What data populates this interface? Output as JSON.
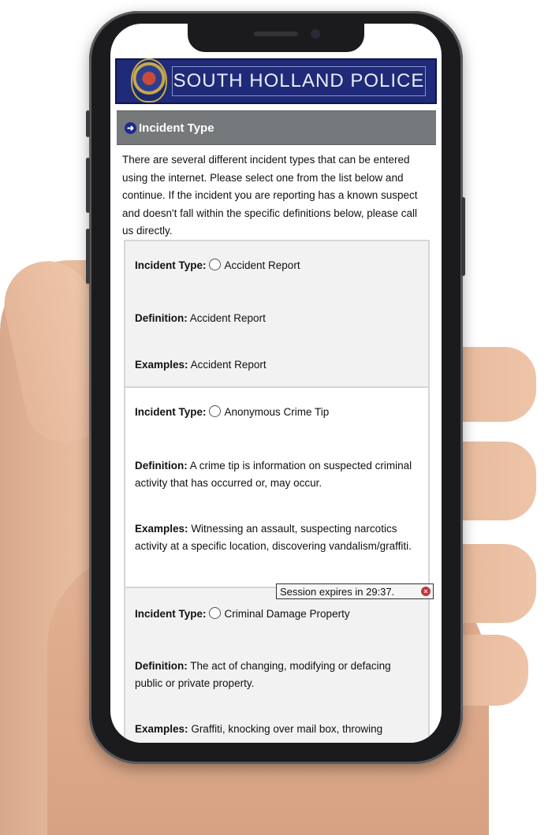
{
  "header": {
    "agency_name": "SOUTH HOLLAND POLICE",
    "badge_icon": "police-badge-icon"
  },
  "section": {
    "title": "Incident Type",
    "icon": "arrow-circle-icon"
  },
  "intro_text": "There are several different incident types that can be entered using the internet. Please select one from the list below and continue. If the incident you are reporting has a known suspect and doesn't fall within the specific definitions below, please call us directly.",
  "labels": {
    "incident_type": "Incident Type:",
    "definition": "Definition:",
    "examples": "Examples:"
  },
  "incident_types": [
    {
      "name": "Accident Report",
      "definition": "Accident Report",
      "examples": "Accident Report"
    },
    {
      "name": "Anonymous Crime Tip",
      "definition": "A crime tip is information on suspected criminal activity that has occurred or, may occur.",
      "examples": "Witnessing an assault, suspecting narcotics activity at a specific location, discovering vandalism/graffiti."
    },
    {
      "name": "Criminal Damage Property",
      "definition": "The act of changing, modifying or defacing public or private property.",
      "examples": "Graffiti, knocking over mail box, throwing"
    }
  ],
  "session": {
    "text": "Session expires in 29:37.",
    "close_icon": "close-circle-icon"
  },
  "colors": {
    "banner_bg": "#1f2a78",
    "section_header_bg": "#76797c",
    "card_bg": "#f2f2f2",
    "session_close": "#c83434"
  }
}
